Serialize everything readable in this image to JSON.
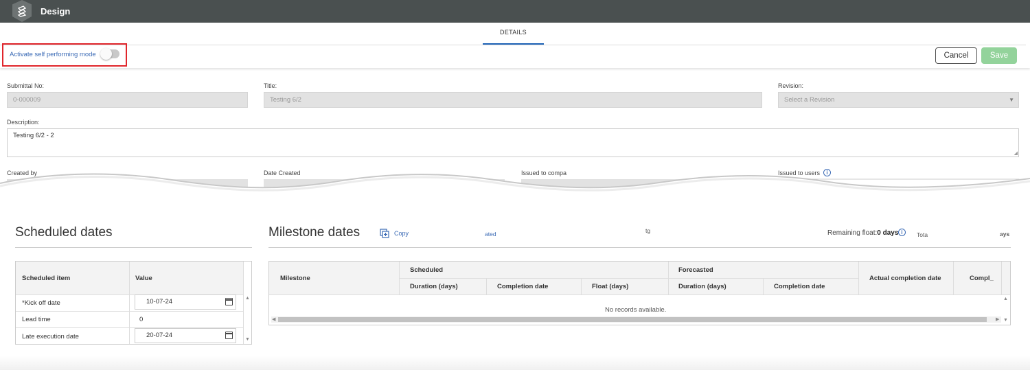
{
  "app": {
    "title": "Design"
  },
  "tabs": [
    {
      "label": "DETAILS"
    }
  ],
  "toolbar": {
    "toggle_label": "Activate self performing mode",
    "toggle_on": false,
    "cancel_label": "Cancel",
    "save_label": "Save"
  },
  "form": {
    "submittal_no_label": "Submittal No:",
    "submittal_no_value": "0-000009",
    "title_label": "Title:",
    "title_value": "Testing 6/2",
    "revision_label": "Revision:",
    "revision_placeholder": "Select a Revision",
    "description_label": "Description:",
    "description_value": "Testing 6/2 - 2",
    "created_by_label": "Created by",
    "date_created_label": "Date Created",
    "issued_to_company_label": "Issued to compa",
    "issued_to_users_label": "Issued to users"
  },
  "scheduled_dates": {
    "title": "Scheduled dates",
    "columns": [
      "Scheduled item",
      "Value"
    ],
    "rows": [
      {
        "item": "*Kick off date",
        "value": "10-07-24",
        "type": "date"
      },
      {
        "item": "Lead time",
        "value": "0",
        "type": "number"
      },
      {
        "item": "Late execution date",
        "value": "20-07-24",
        "type": "date"
      }
    ]
  },
  "milestone_dates": {
    "title": "Milestone dates",
    "copy_label": "Copy",
    "copy_label_suffix": "ated",
    "fragment_mid": "tg",
    "remaining_float_label": "Remaining float:",
    "remaining_float_value": "0 days",
    "total_fragment": "Tota",
    "days_fragment": "ays",
    "columns": {
      "milestone": "Milestone",
      "scheduled_group": "Scheduled",
      "forecasted_group": "Forecasted",
      "duration": "Duration (days)",
      "completion": "Completion date",
      "float": "Float (days)",
      "actual_completion": "Actual completion date",
      "compl": "Compl_"
    },
    "empty_message": "No records available."
  },
  "icons": {
    "logo": "app-logo-icon",
    "calendar": "calendar-icon",
    "info": "info-icon",
    "copy": "copy-icon"
  },
  "colors": {
    "topbar": "#4a5050",
    "accent": "#1e63b6",
    "link": "#3a6ab5",
    "save_disabled": "#93d39b",
    "highlight": "#e0252b"
  }
}
